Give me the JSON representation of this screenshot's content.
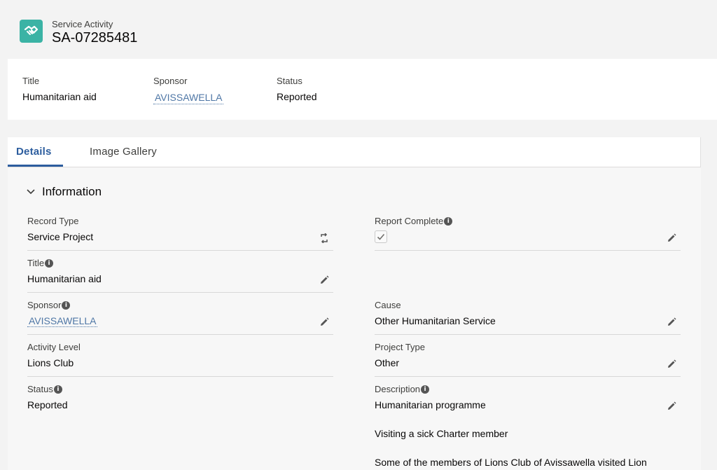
{
  "header": {
    "object_type": "Service Activity",
    "record_name": "SA-07285481",
    "icon": "handshake-icon",
    "icon_color": "#3bb3a5"
  },
  "highlights": {
    "title_label": "Title",
    "title_value": "Humanitarian aid",
    "sponsor_label": "Sponsor",
    "sponsor_value": "AVISSAWELLA",
    "status_label": "Status",
    "status_value": "Reported"
  },
  "tabs": [
    {
      "label": "Details",
      "active": true
    },
    {
      "label": "Image Gallery",
      "active": false
    }
  ],
  "section": {
    "title": "Information",
    "expanded": true
  },
  "fields": {
    "record_type": {
      "label": "Record Type",
      "value": "Service Project"
    },
    "report_complete": {
      "label": "Report Complete",
      "checked": true
    },
    "title": {
      "label": "Title",
      "value": "Humanitarian aid"
    },
    "sponsor": {
      "label": "Sponsor",
      "value": "AVISSAWELLA"
    },
    "cause": {
      "label": "Cause",
      "value": "Other Humanitarian Service"
    },
    "activity_level": {
      "label": "Activity Level",
      "value": "Lions Club"
    },
    "project_type": {
      "label": "Project Type",
      "value": "Other"
    },
    "status": {
      "label": "Status",
      "value": "Reported"
    },
    "description": {
      "label": "Description",
      "lines": [
        "Humanitarian programme",
        "Visiting a sick Charter member",
        "Some of the members of Lions Club of Avissawella visited Lion"
      ]
    }
  },
  "colors": {
    "link": "#4f77a6",
    "active_tab": "#2c5d9e"
  }
}
